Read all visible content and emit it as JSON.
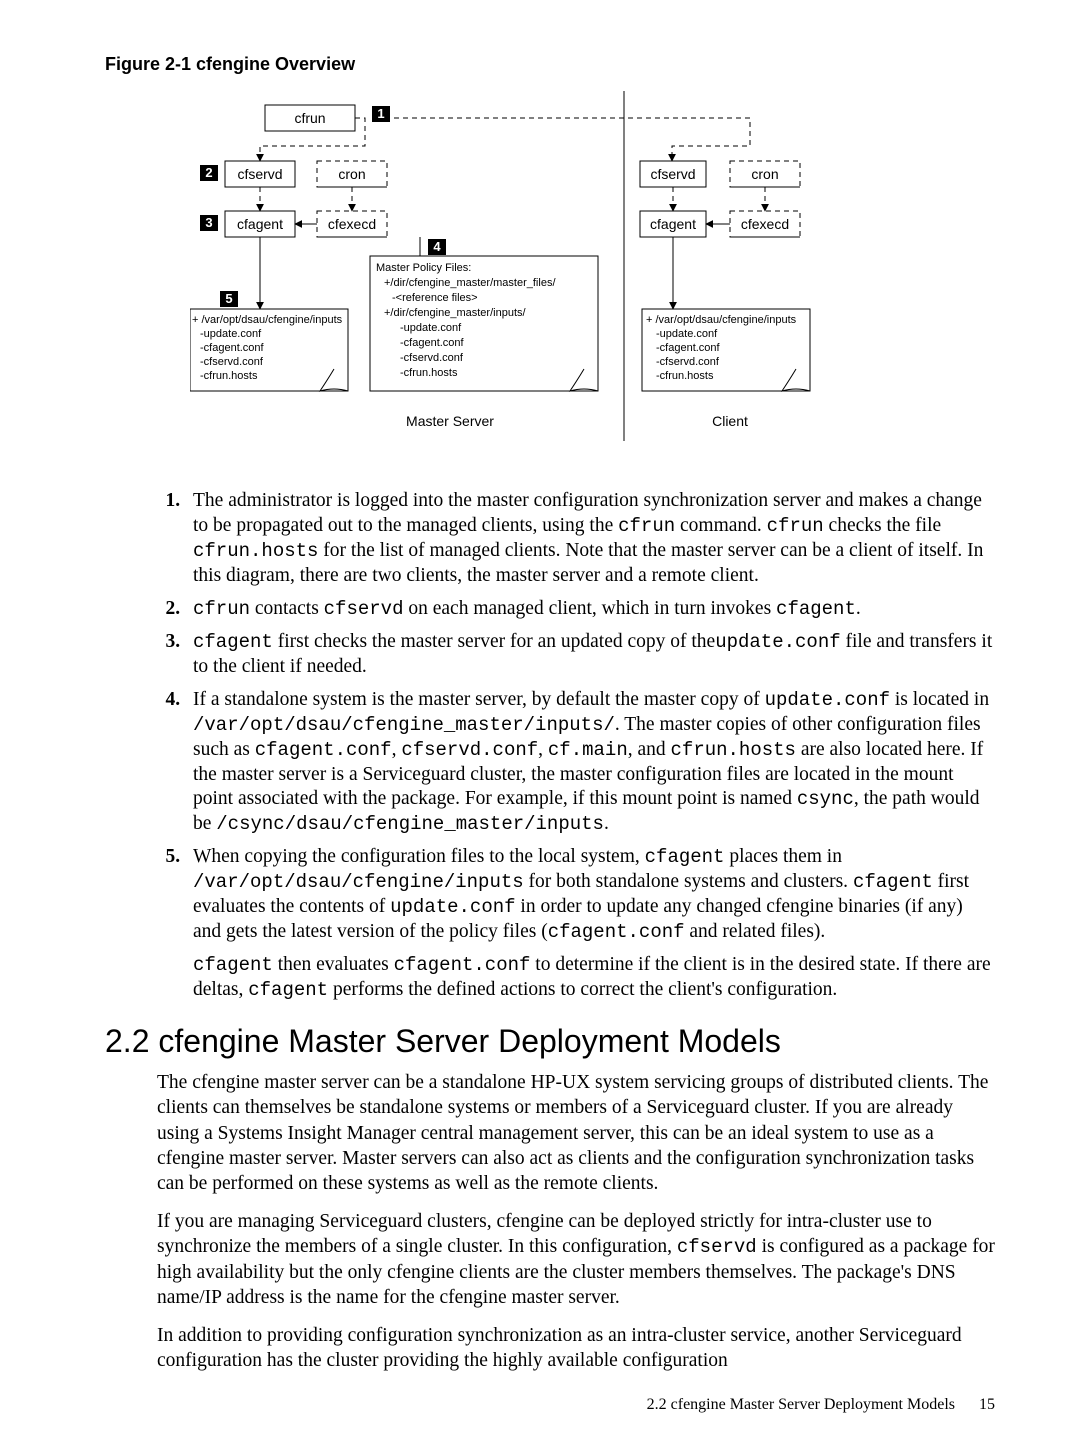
{
  "figure": {
    "title": "Figure 2-1 cfengine Overview",
    "callouts": [
      "1",
      "2",
      "3",
      "4",
      "5"
    ],
    "nodes": {
      "cfrun": "cfrun",
      "cfservd": "cfservd",
      "cron": "cron",
      "cfagent": "cfagent",
      "cfexecd": "cfexecd"
    },
    "masterPolicyHeader": "Master Policy Files:",
    "masterPolicyLines": [
      "+/dir/cfengine_master/master_files/",
      "-<reference files>",
      "+/dir/cfengine_master/inputs/",
      "-update.conf",
      "-cfagent.conf",
      "-cfservd.conf",
      "-cfrun.hosts"
    ],
    "clientInputsHeader": "+ /var/opt/dsau/cfengine/inputs",
    "clientInputsLines": [
      "-update.conf",
      "-cfagent.conf",
      "-cfservd.conf",
      "-cfrun.hosts"
    ],
    "masterServerLabel": "Master Server",
    "clientLabel": "Client"
  },
  "steps_html": [
    "The administrator is logged into the master configuration synchronization server and makes a change to be propagated out to the managed clients, using the <code>cfrun</code> command. <code>cfrun</code> checks the file <code>cfrun.hosts</code> for the list of managed clients. Note that the master server can be a client of itself. In this diagram, there are two clients, the master server and a remote client.",
    "<code>cfrun</code> contacts <code>cfservd</code> on each managed client, which in turn invokes <code>cfagent</code>.",
    "<code>cfagent</code> first checks the master server for an updated copy of the<code>update.conf</code> file and transfers it to the client if needed.",
    "If a standalone system is the master server, by default the master copy of <code>update.conf</code> is located in <code>/var/opt/dsau/cfengine_master/inputs/</code>. The master copies of other configuration files such as <code>cfagent.conf</code>, <code>cfservd.conf</code>, <code>cf.main</code>, and <code>cfrun.hosts</code> are also located here. If the master server is a Serviceguard cluster, the master configuration files are located in the mount point associated with the package. For example, if this mount point is named <code>csync</code>, the path would be <code>/csync/dsau/cfengine_master/inputs</code>.",
    "When copying the configuration files to the local system, <code>cfagent</code> places them in <code>/var/opt/dsau/cfengine/inputs</code> for both standalone systems and clusters. <code>cfagent</code> first evaluates the contents of <code>update.conf</code> in order to update any changed cfengine binaries (if any) and gets the latest version of the policy files (<code>cfagent.conf</code> and related files).<div class=\"followup\"><code>cfagent</code> then evaluates <code>cfagent.conf</code> to determine if the client is in the desired state. If there are deltas, <code>cfagent</code> performs the defined actions to correct the client's configuration.</div>"
  ],
  "section": {
    "number": "2.2",
    "title": "cfengine Master Server Deployment Models"
  },
  "paragraphs_html": [
    "The cfengine master server can be a standalone HP-UX system servicing groups of distributed clients. The clients can themselves be standalone systems or members of a Serviceguard cluster. If you are already using a Systems Insight Manager central management server, this can be an ideal system to use as a cfengine master server. Master servers can also act as clients and the configuration synchronization tasks can be performed on these systems as well as the remote clients.",
    "If you are managing Serviceguard clusters, cfengine can be deployed strictly for intra-cluster use to synchronize the members of a single cluster. In this configuration, <code>cfservd</code> is configured as a package for high availability but the only cfengine clients are the cluster members themselves. The package's DNS name/IP address is the name for the cfengine master server.",
    "In addition to providing configuration synchronization as an intra-cluster service, another Serviceguard configuration has the cluster providing the highly available configuration"
  ],
  "footer": {
    "text": "2.2 cfengine Master Server Deployment Models",
    "page": "15"
  }
}
